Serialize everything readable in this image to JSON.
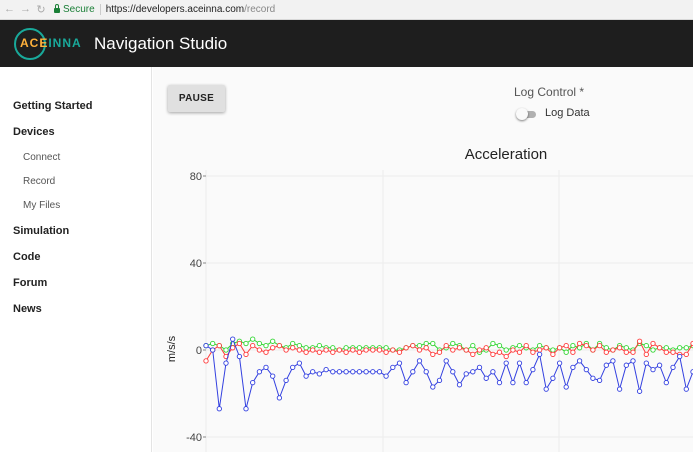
{
  "browser": {
    "secure_label": "Secure",
    "url_host": "https://developers.aceinna.com",
    "url_path": "/record"
  },
  "app": {
    "logo_left": "ACE",
    "logo_right": "INNA",
    "title": "Navigation Studio"
  },
  "sidebar": {
    "items": [
      {
        "label": "Getting Started"
      },
      {
        "label": "Devices"
      },
      {
        "label": "Connect"
      },
      {
        "label": "Record"
      },
      {
        "label": "My Files"
      },
      {
        "label": "Simulation"
      },
      {
        "label": "Code"
      },
      {
        "label": "Forum"
      },
      {
        "label": "News"
      }
    ]
  },
  "toolbar": {
    "pause_label": "PAUSE",
    "log_control_label": "Log Control *",
    "log_data_label": "Log Data",
    "log_data_enabled": false
  },
  "chart_data": {
    "type": "line",
    "title": "Acceleration",
    "ylabel": "m/s/s",
    "xlabel": "",
    "ylim": [
      -40,
      80
    ],
    "yticks": [
      80,
      40,
      0,
      -40
    ],
    "grid": true,
    "colors": {
      "x": "#ff3b3b",
      "y": "#34d634",
      "z": "#3340e0"
    },
    "series": [
      {
        "key": "x",
        "values": [
          -5,
          0,
          2,
          -3,
          1,
          3,
          -2,
          2,
          0,
          -1,
          1,
          2,
          0,
          1,
          0,
          -1,
          0,
          -1,
          0,
          -1,
          0,
          -1,
          0,
          -1,
          0,
          0,
          0,
          -1,
          0,
          -1,
          1,
          2,
          0,
          1,
          -2,
          -1,
          2,
          0,
          1,
          0,
          -2,
          0,
          1,
          -2,
          -1,
          -3,
          0,
          -1,
          2,
          -1,
          0,
          1,
          -2,
          1,
          2,
          -1,
          3,
          2,
          0,
          2,
          -1,
          0,
          1,
          -1,
          -1,
          4,
          -2,
          3,
          1,
          -1,
          -1,
          -2,
          -2,
          3
        ]
      },
      {
        "key": "y",
        "values": [
          2,
          3,
          2,
          0,
          3,
          4,
          3,
          5,
          3,
          2,
          4,
          2,
          1,
          3,
          2,
          1,
          1,
          2,
          1,
          1,
          0,
          1,
          1,
          1,
          1,
          1,
          1,
          1,
          0,
          0,
          1,
          2,
          2,
          3,
          3,
          0,
          1,
          3,
          2,
          0,
          2,
          -1,
          0,
          3,
          2,
          0,
          1,
          2,
          1,
          0,
          2,
          1,
          0,
          1,
          -1,
          2,
          1,
          3,
          0,
          3,
          1,
          0,
          2,
          1,
          0,
          3,
          2,
          0,
          1,
          1,
          0,
          1,
          1,
          2
        ]
      },
      {
        "key": "z",
        "values": [
          2,
          0,
          -27,
          -6,
          5,
          -3,
          -27,
          -15,
          -10,
          -8,
          -12,
          -22,
          -14,
          -8,
          -6,
          -12,
          -10,
          -11,
          -9,
          -10,
          -10,
          -10,
          -10,
          -10,
          -10,
          -10,
          -10,
          -12,
          -8,
          -6,
          -15,
          -10,
          -5,
          -10,
          -17,
          -14,
          -5,
          -10,
          -16,
          -11,
          -10,
          -8,
          -13,
          -10,
          -15,
          -6,
          -15,
          -6,
          -15,
          -9,
          -2,
          -18,
          -13,
          -6,
          -17,
          -8,
          -5,
          -9,
          -13,
          -14,
          -7,
          -5,
          -18,
          -7,
          -5,
          -19,
          -6,
          -9,
          -7,
          -15,
          -8,
          -3,
          -18,
          -10
        ]
      }
    ]
  }
}
